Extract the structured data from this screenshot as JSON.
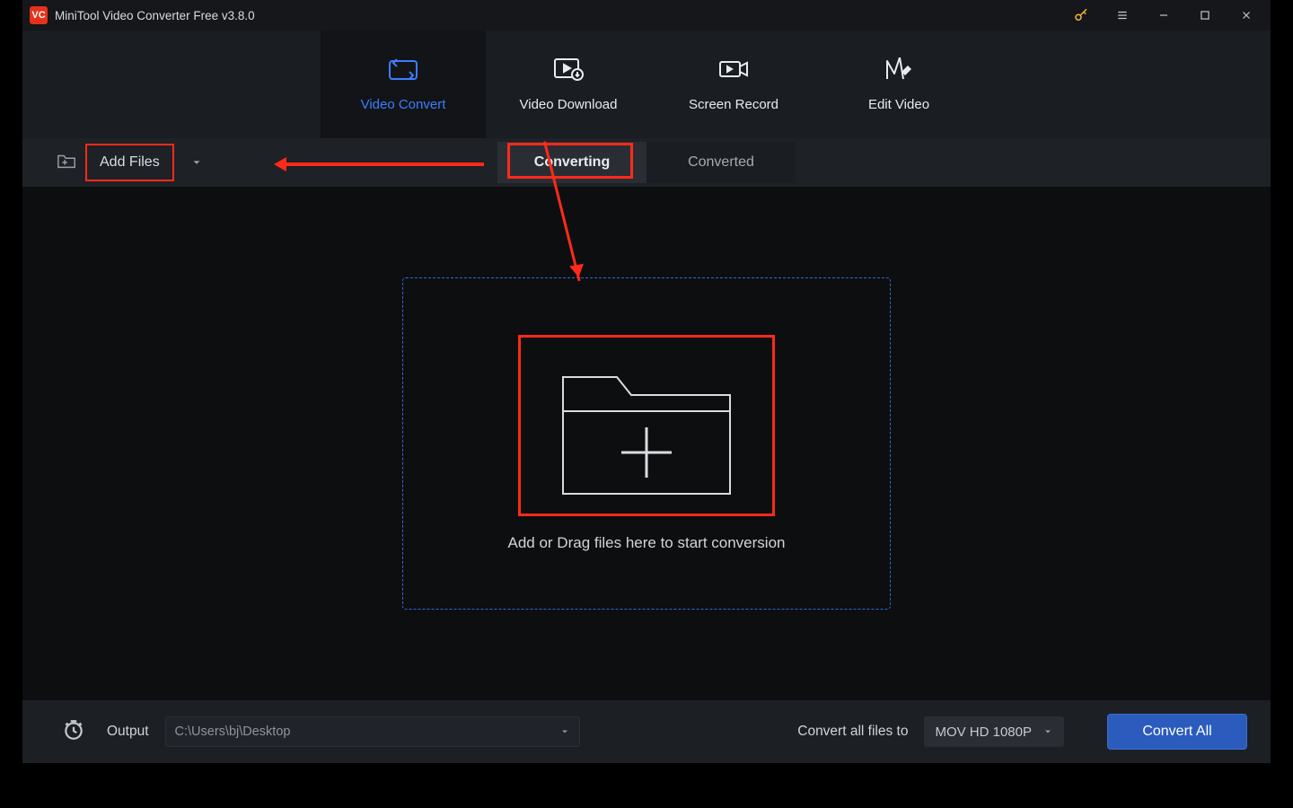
{
  "titlebar": {
    "title": "MiniTool Video Converter Free v3.8.0"
  },
  "nav": {
    "items": [
      {
        "label": "Video Convert"
      },
      {
        "label": "Video Download"
      },
      {
        "label": "Screen Record"
      },
      {
        "label": "Edit Video"
      }
    ]
  },
  "toolbar": {
    "add_files_label": "Add Files",
    "sub_tabs": [
      {
        "label": "Converting"
      },
      {
        "label": "Converted"
      }
    ]
  },
  "main": {
    "drop_text": "Add or Drag files here to start conversion"
  },
  "footer": {
    "output_label": "Output",
    "output_path": "C:\\Users\\bj\\Desktop",
    "convert_all_files_label": "Convert all files to",
    "format_selected": "MOV HD 1080P",
    "convert_all_button": "Convert All"
  }
}
